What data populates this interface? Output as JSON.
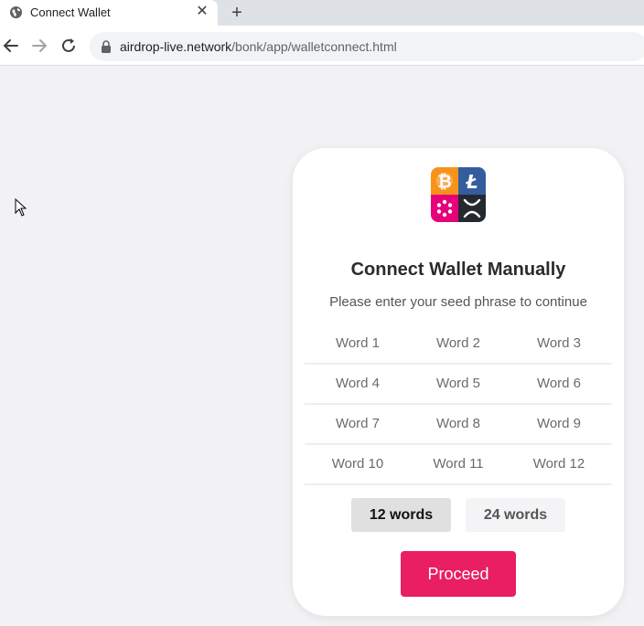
{
  "browser": {
    "tab_title": "Connect Wallet",
    "tab_close": "✕",
    "new_tab": "+",
    "url_host": "airdrop-live.network",
    "url_path": "/bonk/app/walletconnect.html"
  },
  "card": {
    "title": "Connect Wallet Manually",
    "subtitle": "Please enter your seed phrase to continue",
    "logo_colors": {
      "bitcoin": "#f7931a",
      "litecoin": "#345d9d",
      "polkadot": "#e6007a",
      "xrp": "#23292f"
    },
    "word_rows": [
      [
        "Word 1",
        "Word 2",
        "Word 3"
      ],
      [
        "Word 4",
        "Word 5",
        "Word 6"
      ],
      [
        "Word 7",
        "Word 8",
        "Word 9"
      ],
      [
        "Word 10",
        "Word 11",
        "Word 12"
      ]
    ],
    "count_options": [
      "12 words",
      "24 words"
    ],
    "selected_count": "12 words",
    "proceed_label": "Proceed",
    "accent_color": "#e91e63"
  }
}
